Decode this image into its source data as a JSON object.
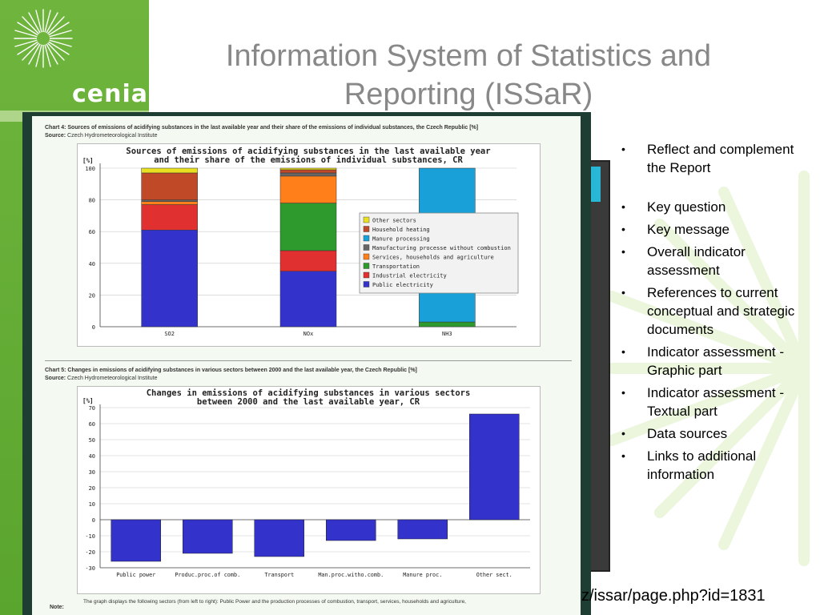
{
  "slide": {
    "title_line1": "Information System of Statistics and",
    "title_line2": "Reporting (ISSaR)",
    "logo_text": "cenia",
    "url": "z/issar/page.php?id=1831",
    "bullets": [
      "Reflect and complement the Report",
      "Key question",
      "Key message",
      "Overall indicator assessment",
      "References to current conceptual and strategic documents",
      "Indicator assessment - Graphic part",
      "Indicator assessment - Textual part",
      "Data sources",
      "Links to additional information"
    ],
    "colors": {
      "brand_green": "#6fb53d",
      "panel_dark": "#1e3d33"
    }
  },
  "chart4": {
    "heading": "Chart 4: Sources of emissions of acidifying substances in the last available year and their share of the emissions of individual substances, the Czech Republic [%]",
    "source_label": "Source:",
    "source_text": "Czech Hydrometeorological Institute"
  },
  "chart5": {
    "heading": "Chart 5: Changes in emissions of acidifying substances in various sectors between 2000 and the last available year, the Czech Republic [%]",
    "source_label": "Source:",
    "source_text": "Czech Hydrometeorological Institute"
  },
  "note": {
    "label": "Note:",
    "text": "The graph displays the following sectors (from left to right): Public Power and the production processes of combustion, transport, services, households and agriculture,"
  },
  "chart_data": [
    {
      "type": "bar",
      "stacked": true,
      "title": "Sources of emissions of acidifying substances in the last available year and their share of the emissions of individual substances, CR",
      "title_lines": [
        "Sources of emissions of acidifying substances in the last available year",
        "and their share of the emissions of individual substances, CR"
      ],
      "ylabel": "[%]",
      "categories": [
        "SO2",
        "NOx",
        "NH3"
      ],
      "ylim": [
        0,
        100
      ],
      "yticks": [
        0,
        20,
        40,
        60,
        80,
        100
      ],
      "grid": true,
      "legend_position": "right",
      "series": [
        {
          "name": "Public electricity",
          "color": "#3333cc",
          "values": [
            61,
            35,
            0
          ]
        },
        {
          "name": "Industrial electricity",
          "color": "#e03030",
          "values": [
            16,
            13,
            0
          ]
        },
        {
          "name": "Transportation",
          "color": "#2e9a2e",
          "values": [
            0,
            30,
            3
          ]
        },
        {
          "name": "Services, households and agriculture",
          "color": "#ff7f1a",
          "values": [
            2,
            17,
            0
          ]
        },
        {
          "name": "Manufacturing processe without combustion",
          "color": "#666666",
          "values": [
            1,
            2,
            0
          ]
        },
        {
          "name": "Manure processing",
          "color": "#1aa0d8",
          "values": [
            0,
            0,
            97
          ]
        },
        {
          "name": "Household heating",
          "color": "#c04a28",
          "values": [
            17,
            2,
            0
          ]
        },
        {
          "name": "Other sectors",
          "color": "#e8e020",
          "values": [
            3,
            1,
            0
          ]
        }
      ]
    },
    {
      "type": "bar",
      "title": "Changes in emissions of acidifying substances in various sectors between 2000 and the last available year, CR",
      "title_lines": [
        "Changes in emissions of acidifying substances in various sectors",
        "between 2000 and the last available year, CR"
      ],
      "ylabel": "[%]",
      "categories": [
        "Public power",
        "Produc.proc.of comb.",
        "Transport",
        "Man.proc.witho.comb.",
        "Manure proc.",
        "Other sect."
      ],
      "values": [
        -26,
        -21,
        -23,
        -13,
        -12,
        66
      ],
      "ylim": [
        -30,
        70
      ],
      "yticks": [
        -30,
        -20,
        -10,
        0,
        10,
        20,
        30,
        40,
        50,
        60,
        70
      ],
      "grid": true,
      "color": "#3333cc"
    }
  ]
}
